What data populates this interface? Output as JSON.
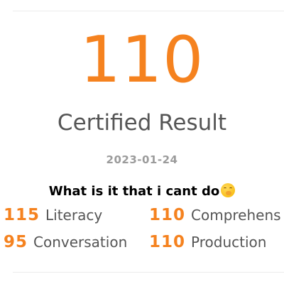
{
  "result": {
    "score": "110",
    "title": "Certified Result",
    "date": "2023-01-24"
  },
  "caption": {
    "text": "What is it that i cant do",
    "emoji": "hand-over-mouth-face"
  },
  "subscores": [
    {
      "score": "115",
      "label": "Literacy"
    },
    {
      "score": "110",
      "label": "Comprehens"
    },
    {
      "score": "95",
      "label": "Conversation"
    },
    {
      "score": "110",
      "label": "Production"
    }
  ],
  "colors": {
    "accent": "#f5821f",
    "text": "#555555",
    "muted": "#9b9b9b"
  }
}
